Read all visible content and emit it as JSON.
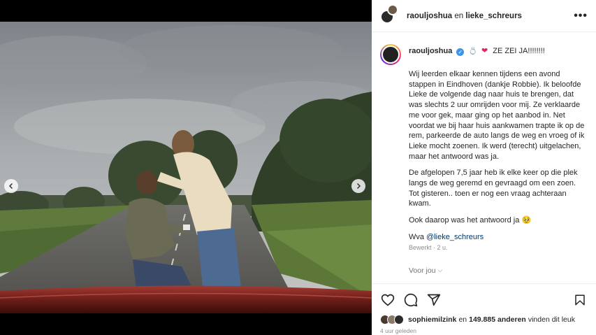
{
  "header": {
    "user1": "raouljoshua",
    "connector": "en",
    "user2": "lieke_schreurs",
    "more": "•••"
  },
  "caption": {
    "username": "raouljoshua",
    "headline": "ZE ZEI JA!!!!!!!!",
    "verified_mark": "✓",
    "emoji_ring": "💍",
    "emoji_heart": "❤",
    "paragraph1": "Wij leerden elkaar kennen tijdens een avond stappen in Eindhoven (dankje Robbie). Ik beloofde Lieke de volgende dag naar huis te brengen, dat was slechts 2 uur omrijden voor mij. Ze verklaarde me voor gek, maar ging op het aanbod in. Net voordat we bij haar huis aankwamen trapte ik op de rem, parkeerde de auto langs de weg en vroeg of ik Lieke mocht zoenen. Ik werd (terecht) uitgelachen, maar het antwoord was ja.",
    "paragraph2": "De afgelopen 7,5 jaar heb ik elke keer op die plek langs de weg geremd en gevraagd om een zoen. Tot gisteren.. toen er nog een vraag achteraan kwam.",
    "paragraph3": "Ook daarop was het antwoord ja",
    "paragraph3_emoji": "🥹",
    "credit_prefix": "Wva",
    "credit_mention": "@lieke_schreurs",
    "edited": "Bewerkt",
    "edited_sep": "·",
    "edited_age": "2 u.",
    "for_you": "Voor jou",
    "for_you_chevron": "⌵"
  },
  "likes": {
    "liked_by": "sophiemilzink",
    "connector": "en",
    "count": "149.885 anderen",
    "suffix": "vinden dit leuk"
  },
  "timestamp": "4 uur geleden",
  "icons": {
    "like": "heart-icon",
    "comment": "comment-icon",
    "share": "share-icon",
    "save": "bookmark-icon",
    "prev": "chevron-left-icon",
    "next": "chevron-right-icon"
  },
  "colors": {
    "verified": "#3897f0",
    "mention": "#00376b",
    "heart_emoji": "#e0245e",
    "secondary_text": "#8e8e8e"
  }
}
